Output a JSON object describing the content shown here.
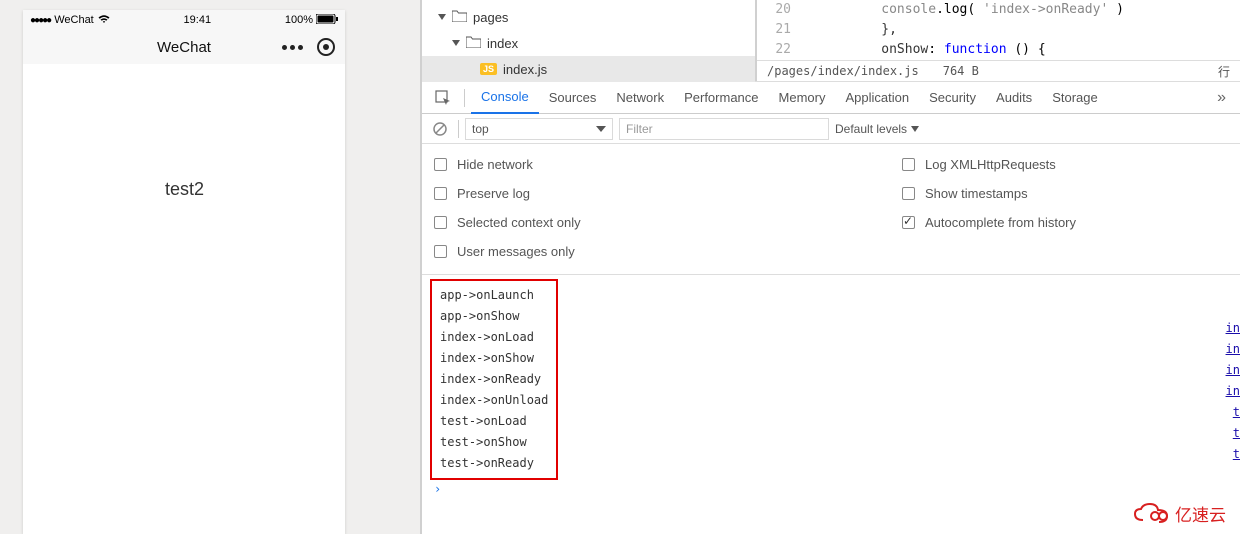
{
  "phone": {
    "carrier": "WeChat",
    "time": "19:41",
    "battery_pct": "100%",
    "nav_title": "WeChat",
    "page_content": "test2"
  },
  "file_tree": {
    "items": [
      {
        "label": "pages"
      },
      {
        "label": "index"
      },
      {
        "label": "index.js"
      }
    ]
  },
  "code": {
    "line_numbers": [
      "20",
      "21",
      "22"
    ],
    "lines": [
      {
        "indent": "          ",
        "brace": "},"
      },
      {
        "indent": "          ",
        "prop": "onShow",
        "sep": ": ",
        "kw": "function",
        "rest": " () {"
      }
    ]
  },
  "file_status": {
    "path": "/pages/index/index.js",
    "size": "764 B",
    "right_label": "行"
  },
  "devtools_tabs": [
    "Console",
    "Sources",
    "Network",
    "Performance",
    "Memory",
    "Application",
    "Security",
    "Audits",
    "Storage"
  ],
  "active_tab_index": 0,
  "console_controls": {
    "context": "top",
    "filter_placeholder": "Filter",
    "levels": "Default levels"
  },
  "console_settings": {
    "left": [
      {
        "label": "Hide network",
        "checked": false
      },
      {
        "label": "Preserve log",
        "checked": false
      },
      {
        "label": "Selected context only",
        "checked": false
      },
      {
        "label": "User messages only",
        "checked": false
      }
    ],
    "right": [
      {
        "label": "Log XMLHttpRequests",
        "checked": false
      },
      {
        "label": "Show timestamps",
        "checked": false
      },
      {
        "label": "Autocomplete from history",
        "checked": true
      }
    ]
  },
  "console_logs": [
    "app->onLaunch",
    "app->onShow",
    "index->onLoad",
    "index->onShow",
    "index->onReady",
    "index->onUnload",
    "test->onLoad",
    "test->onShow",
    "test->onReady"
  ],
  "source_links": [
    "",
    "",
    "in",
    "in",
    "in",
    "in",
    "t",
    "t",
    "t"
  ],
  "watermark": "亿速云"
}
